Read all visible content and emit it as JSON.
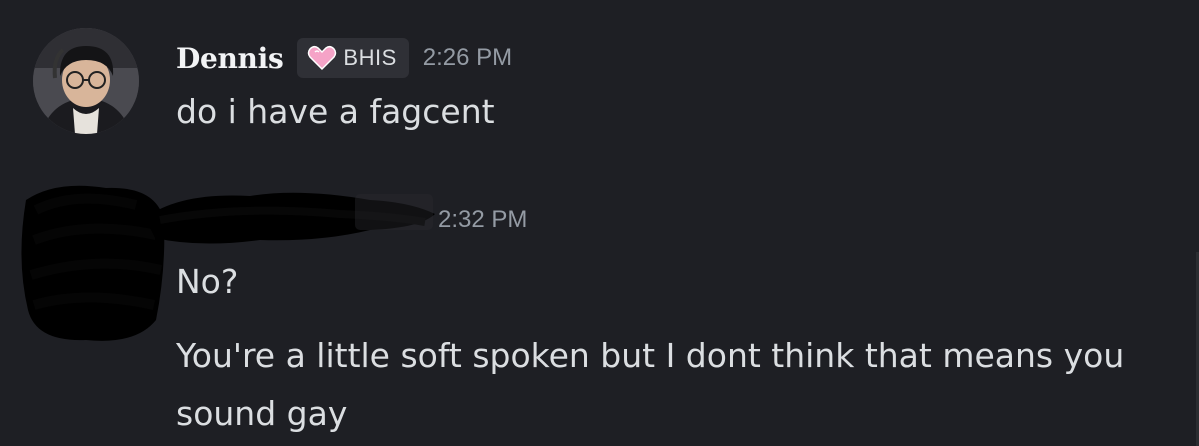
{
  "messages": [
    {
      "author": "Dennis",
      "tag": {
        "label": "BHIS",
        "icon": "pink-heart-icon"
      },
      "timestamp": "2:26 PM",
      "lines": [
        "do i have a fagcent"
      ]
    },
    {
      "author": "",
      "timestamp": "2:32 PM",
      "lines": [
        "No?",
        "You're a little soft spoken but I dont think that means you sound gay"
      ]
    }
  ],
  "colors": {
    "background": "#1e1f24",
    "username": "#f2f3f5",
    "text": "#dbdee1",
    "timestamp": "#949ba4",
    "tag_bg": "#2f3036",
    "heart": "#f5a3c7"
  }
}
